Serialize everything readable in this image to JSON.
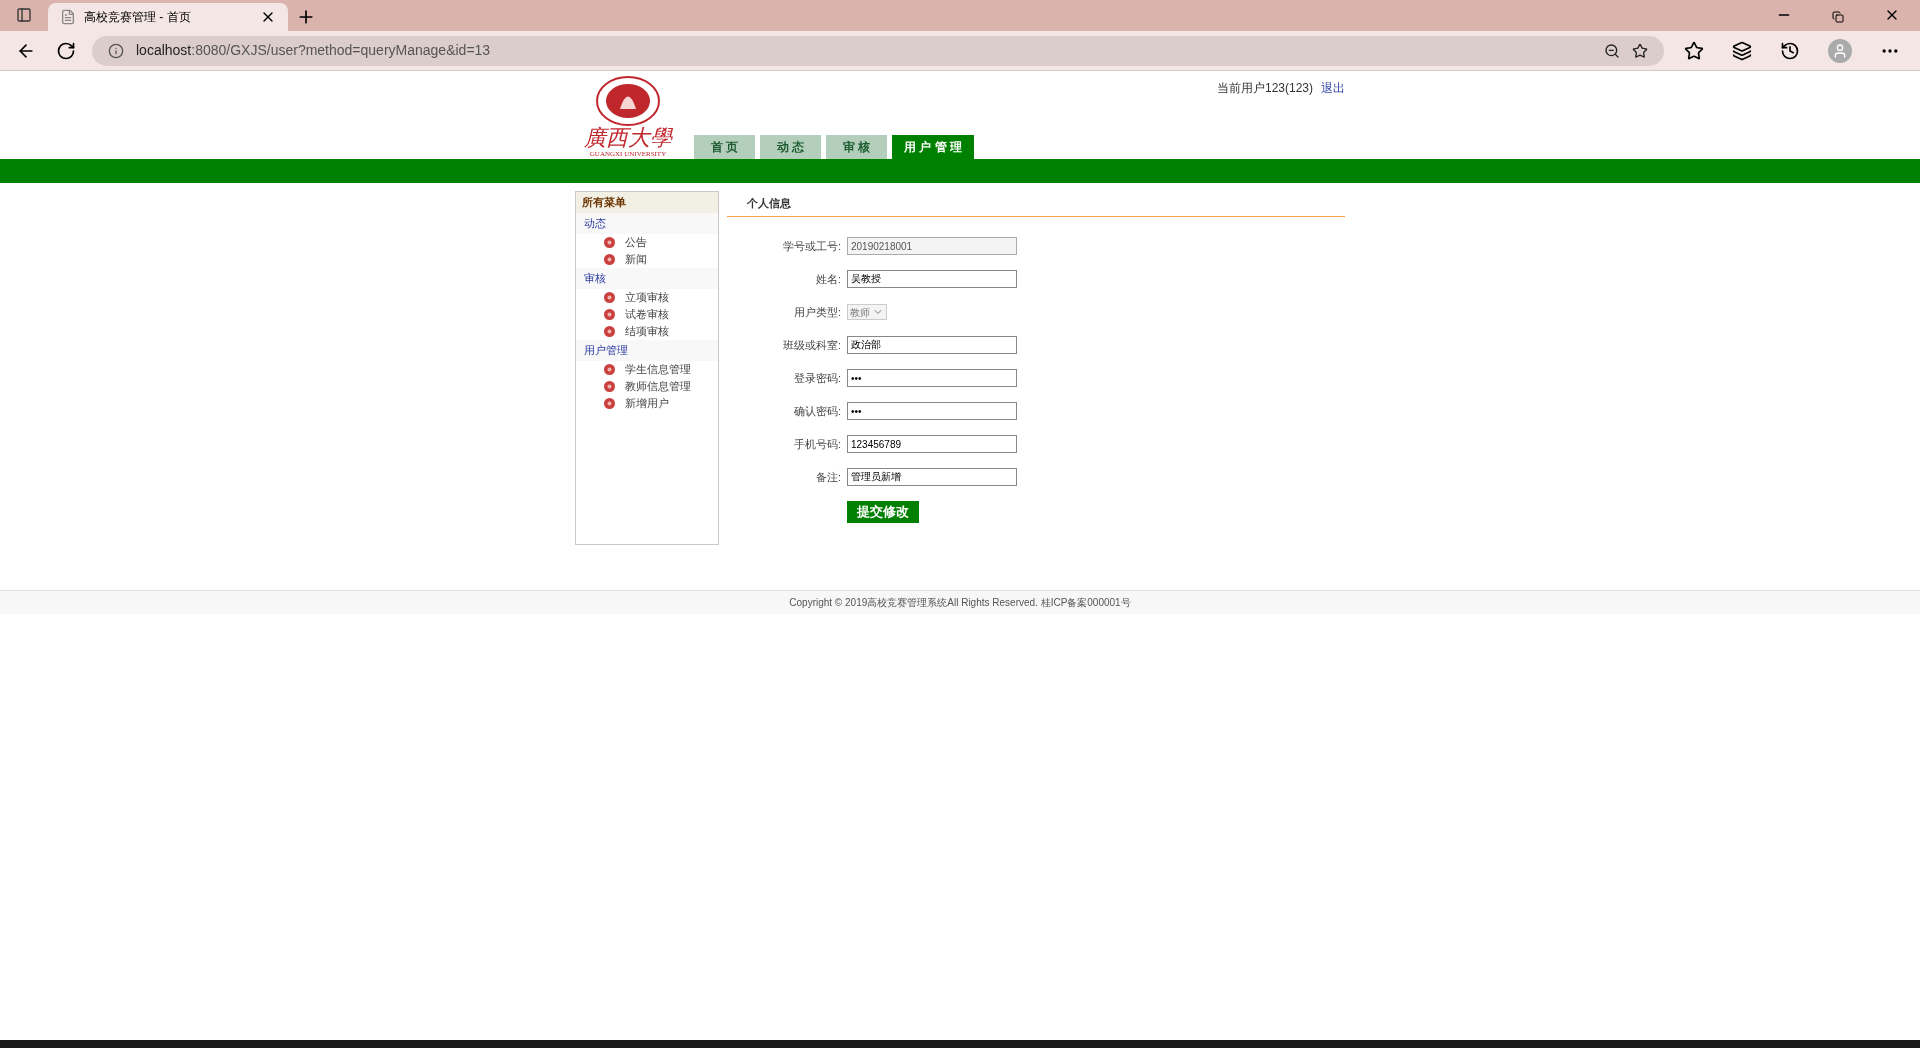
{
  "browser": {
    "tab_title": "高校竞赛管理 - 首页",
    "url_host": "localhost",
    "url_rest": ":8080/GXJS/user?method=queryManage&id=13"
  },
  "header": {
    "user": "当前用户123(123)",
    "logout": "退出",
    "logo_text": "廣西大學",
    "logo_subtext": "GUANGXI UNIVERSITY"
  },
  "tabs": [
    {
      "label": "首 页",
      "selected": false
    },
    {
      "label": "动 态",
      "selected": false
    },
    {
      "label": "审 核",
      "selected": false
    },
    {
      "label": "用 户 管 理",
      "selected": true
    }
  ],
  "sidebar": {
    "title": "所有菜单",
    "groups": [
      {
        "label": "动态",
        "children": [
          {
            "label": "公告"
          },
          {
            "label": "新闻"
          }
        ]
      },
      {
        "label": "审核",
        "children": [
          {
            "label": "立项审核"
          },
          {
            "label": "试卷审核"
          },
          {
            "label": "结项审核"
          }
        ]
      },
      {
        "label": "用户管理",
        "children": [
          {
            "label": "学生信息管理"
          },
          {
            "label": "教师信息管理"
          },
          {
            "label": "新增用户"
          }
        ]
      }
    ]
  },
  "panel": {
    "title": "个人信息",
    "fields": [
      {
        "label": "学号或工号:",
        "kind": "input",
        "value": "20190218001",
        "disabled": true
      },
      {
        "label": "姓名:",
        "kind": "input",
        "value": "吴教授",
        "disabled": false
      },
      {
        "label": "用户类型:",
        "kind": "select",
        "value": "教师",
        "disabled": true
      },
      {
        "label": "班级或科室:",
        "kind": "input",
        "value": "政治部",
        "disabled": false
      },
      {
        "label": "登录密码:",
        "kind": "input",
        "value": "•••",
        "disabled": false
      },
      {
        "label": "确认密码:",
        "kind": "input",
        "value": "•••",
        "disabled": false
      },
      {
        "label": "手机号码:",
        "kind": "input",
        "value": "123456789",
        "disabled": false
      },
      {
        "label": "备注:",
        "kind": "input",
        "value": "管理员新增",
        "disabled": false
      }
    ],
    "submit": "提交修改"
  },
  "footer": "Copyright © 2019高校竞赛管理系统All Rights Reserved. 桂ICP备案000001号"
}
